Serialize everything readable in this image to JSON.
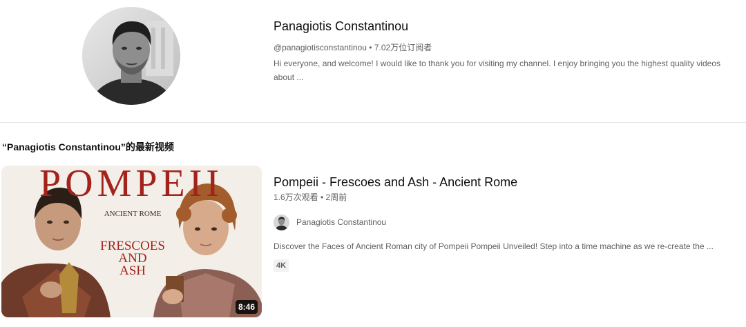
{
  "channel": {
    "name": "Panagiotis Constantinou",
    "handle": "@panagiotisconstantinou",
    "subscribers": "• 7.02万位订阅者",
    "description": "Hi everyone, and welcome! I would like to thank you for visiting my channel. I enjoy bringing you the highest quality videos about ..."
  },
  "section": {
    "title": "“Panagiotis Constantinou”的最新视频"
  },
  "video": {
    "title": "Pompeii - Frescoes and Ash - Ancient Rome",
    "meta": "1.6万次观看 • 2周前",
    "channel_name": "Panagiotis Constantinou",
    "description": "Discover the Faces of Ancient Roman city of Pompeii Pompeii Unveiled! Step into a time machine as we re-create the ...",
    "badge": "4K",
    "duration": "8:46",
    "thumbnail": {
      "headline": "POMPEII",
      "subtitle": "ANCIENT ROME",
      "tagline_1": "FRESCOES",
      "tagline_2": "AND",
      "tagline_3": "ASH"
    }
  },
  "colors": {
    "title_red": "#a3231c",
    "text_primary": "#0f0f0f",
    "text_secondary": "#606060"
  }
}
